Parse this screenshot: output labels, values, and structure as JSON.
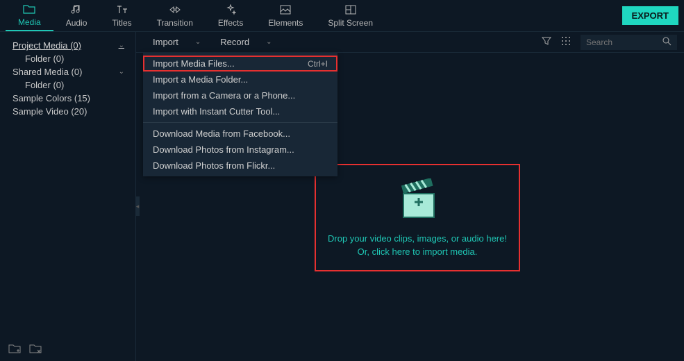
{
  "nav": {
    "media": "Media",
    "audio": "Audio",
    "titles": "Titles",
    "transition": "Transition",
    "effects": "Effects",
    "elements": "Elements",
    "splitscreen": "Split Screen"
  },
  "export": "EXPORT",
  "sidebar": {
    "project_media": "Project Media (0)",
    "project_folder": "Folder (0)",
    "shared_media": "Shared Media (0)",
    "shared_folder": "Folder (0)",
    "sample_colors": "Sample Colors (15)",
    "sample_video": "Sample Video (20)"
  },
  "toolbar": {
    "import": "Import",
    "record": "Record"
  },
  "search": {
    "placeholder": "Search"
  },
  "dropdown": {
    "import_files": "Import Media Files...",
    "import_files_shortcut": "Ctrl+I",
    "import_folder": "Import a Media Folder...",
    "import_camera": "Import from a Camera or a Phone...",
    "import_cutter": "Import with Instant Cutter Tool...",
    "dl_facebook": "Download Media from Facebook...",
    "dl_instagram": "Download Photos from Instagram...",
    "dl_flickr": "Download Photos from Flickr..."
  },
  "dropzone": {
    "line1": "Drop your video clips, images, or audio here!",
    "line2": "Or, click here to import media."
  }
}
